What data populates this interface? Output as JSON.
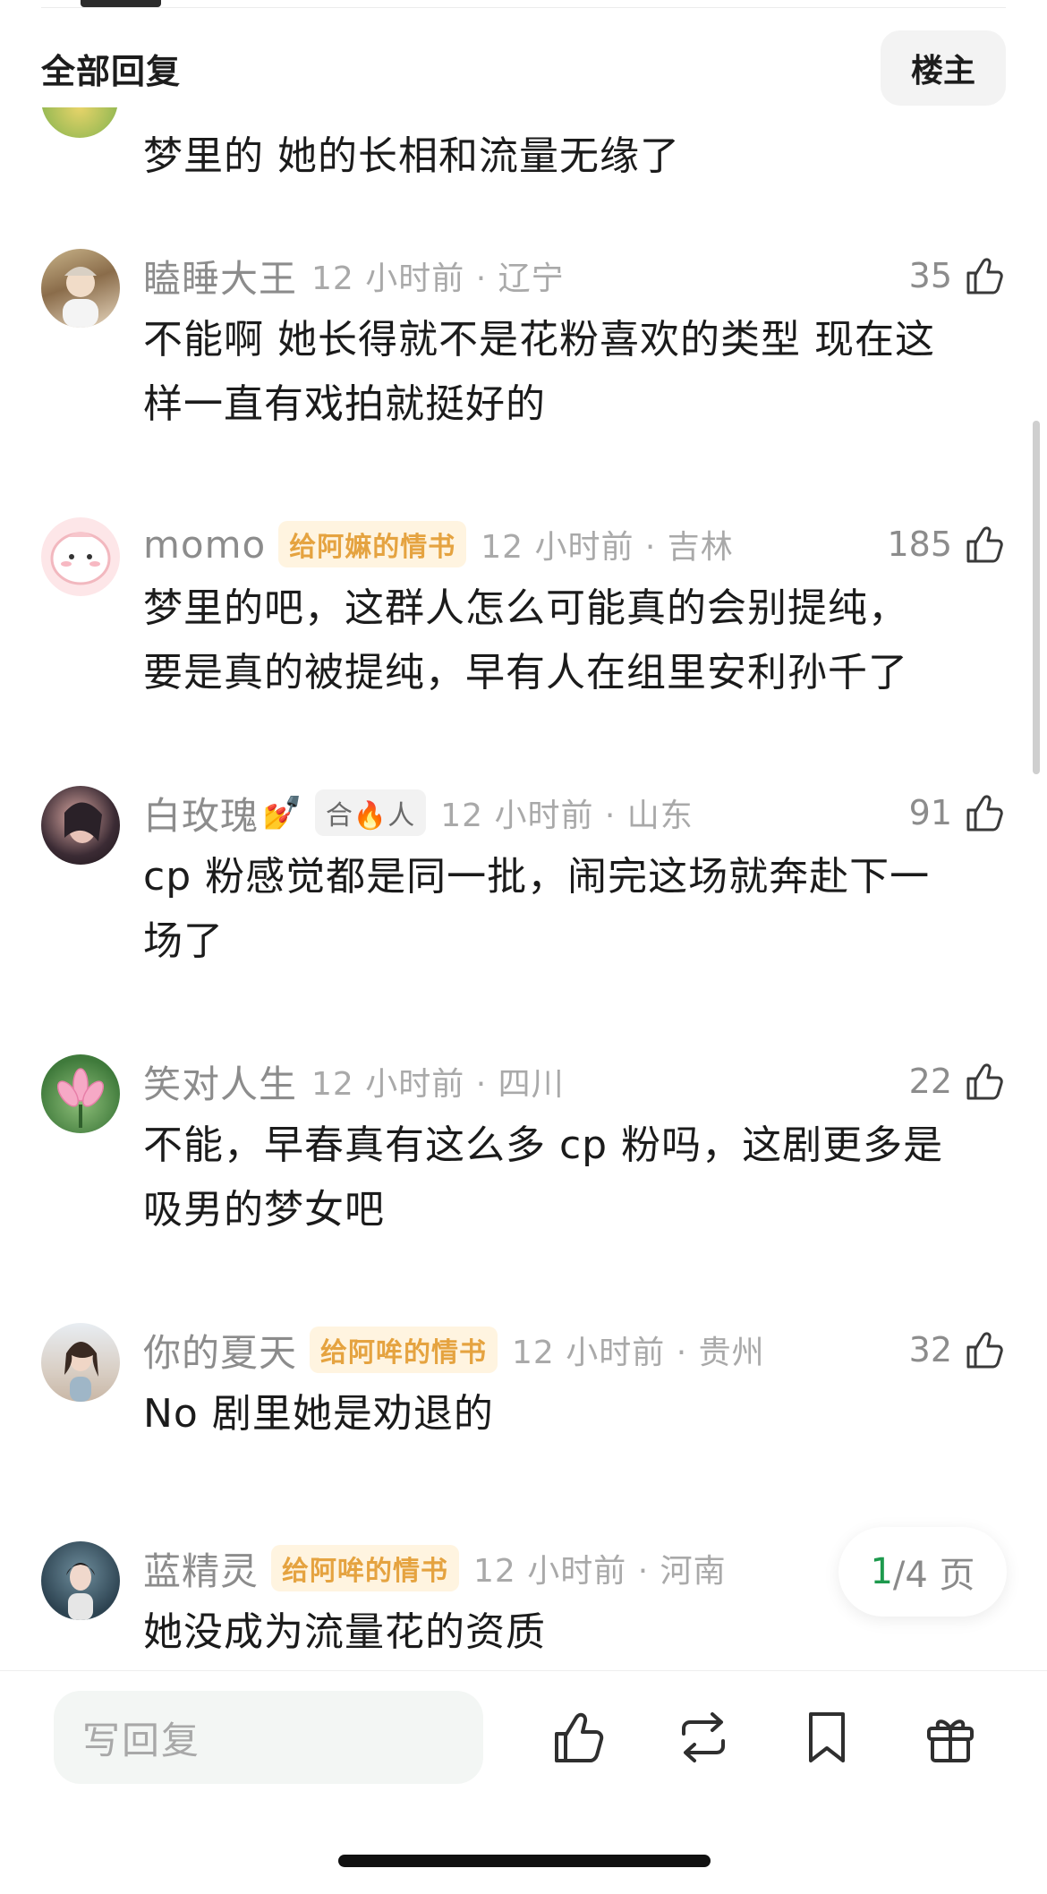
{
  "header": {
    "title": "全部回复",
    "op_button": "楼主"
  },
  "partial_comment": {
    "text": "梦里的 她的长相和流量无缘了"
  },
  "comments": [
    {
      "username": "瞌睡大王",
      "emoji": "",
      "badge": "",
      "meta": "12 小时前 · 辽宁",
      "likes": "35",
      "lines": [
        "不能啊 她长得就不是花粉喜欢的类型 现在这",
        "样一直有戏拍就挺好的"
      ]
    },
    {
      "username": "momo",
      "emoji": "",
      "badge": "给阿嫲的情书",
      "meta": "12 小时前 · 吉林",
      "likes": "185",
      "lines": [
        "梦里的吧，这群人怎么可能真的会别提纯，",
        "要是真的被提纯，早有人在组里安利孙千了"
      ]
    },
    {
      "username": "白玫瑰",
      "emoji": "💅",
      "badge": "合🔥人",
      "meta": "12 小时前 · 山东",
      "likes": "91",
      "lines": [
        "cp 粉感觉都是同一批，闹完这场就奔赴下一",
        "场了"
      ]
    },
    {
      "username": "笑对人生",
      "emoji": "",
      "badge": "",
      "meta": "12 小时前 · 四川",
      "likes": "22",
      "lines": [
        "不能，早春真有这么多 cp 粉吗，这剧更多是",
        "吸男的梦女吧"
      ]
    },
    {
      "username": "你的夏天",
      "emoji": "",
      "badge": "给阿哞的情书",
      "meta": "12 小时前 · 贵州",
      "likes": "32",
      "lines": [
        "No 剧里她是劝退的"
      ]
    },
    {
      "username": "蓝精灵",
      "emoji": "",
      "badge": "给阿哞的情书",
      "meta": "12 小时前 · 河南",
      "likes": "",
      "lines": [
        "她没成为流量花的资质"
      ]
    }
  ],
  "pagination": {
    "current": "1",
    "total": "/4 页"
  },
  "bottom_bar": {
    "reply_placeholder": "写回复",
    "icons": [
      "like-icon",
      "repost-icon",
      "bookmark-icon",
      "gift-icon"
    ]
  },
  "colors": {
    "accent": "#1e9a4e",
    "badge_text": "#e5a340",
    "badge_bg": "#fff4e0"
  }
}
